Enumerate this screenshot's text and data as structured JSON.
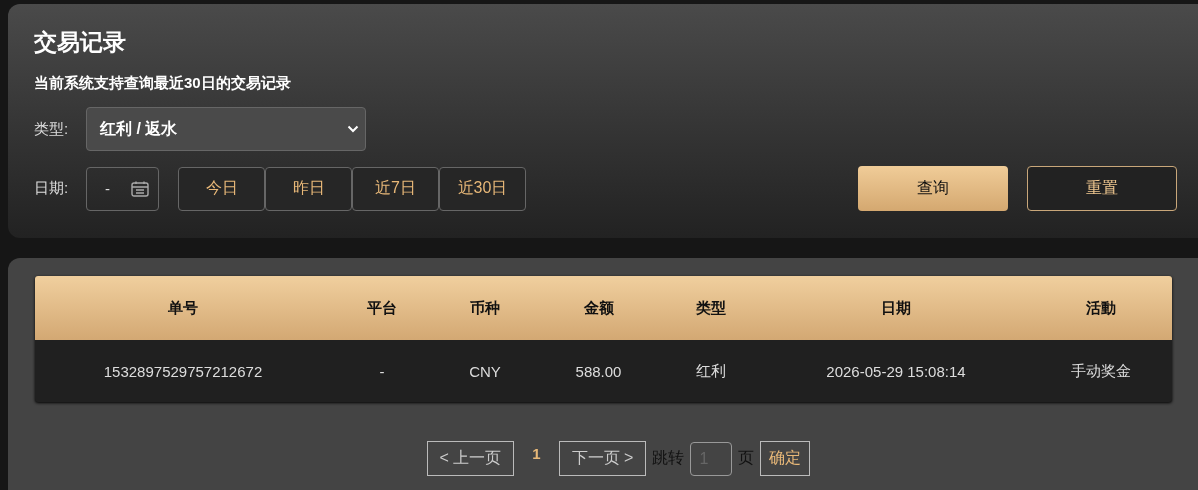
{
  "title": "交易记录",
  "notice": "当前系统支持查询最近30日的交易记录",
  "type_filter": {
    "label": "类型:",
    "value": "红利 / 返水"
  },
  "date_filter": {
    "label": "日期:",
    "value": "-"
  },
  "date_shortcuts": [
    "今日",
    "昨日",
    "近7日",
    "近30日"
  ],
  "buttons": {
    "search": "查询",
    "reset": "重置"
  },
  "table": {
    "columns": [
      "单号",
      "平台",
      "币种",
      "金额",
      "类型",
      "日期",
      "活動"
    ],
    "rows": [
      [
        "1532897529757212672",
        "-",
        "CNY",
        "588.00",
        "红利",
        "2026-05-29 15:08:14",
        "手动奖金"
      ]
    ]
  },
  "pagination": {
    "prev": "< 上一页",
    "pages": [
      {
        "label": "1",
        "selected": true
      }
    ],
    "next": "下一页 >",
    "jump_label": "跳转",
    "jump_placeholder": "1",
    "page_unit": "页",
    "confirm": "确定"
  }
}
